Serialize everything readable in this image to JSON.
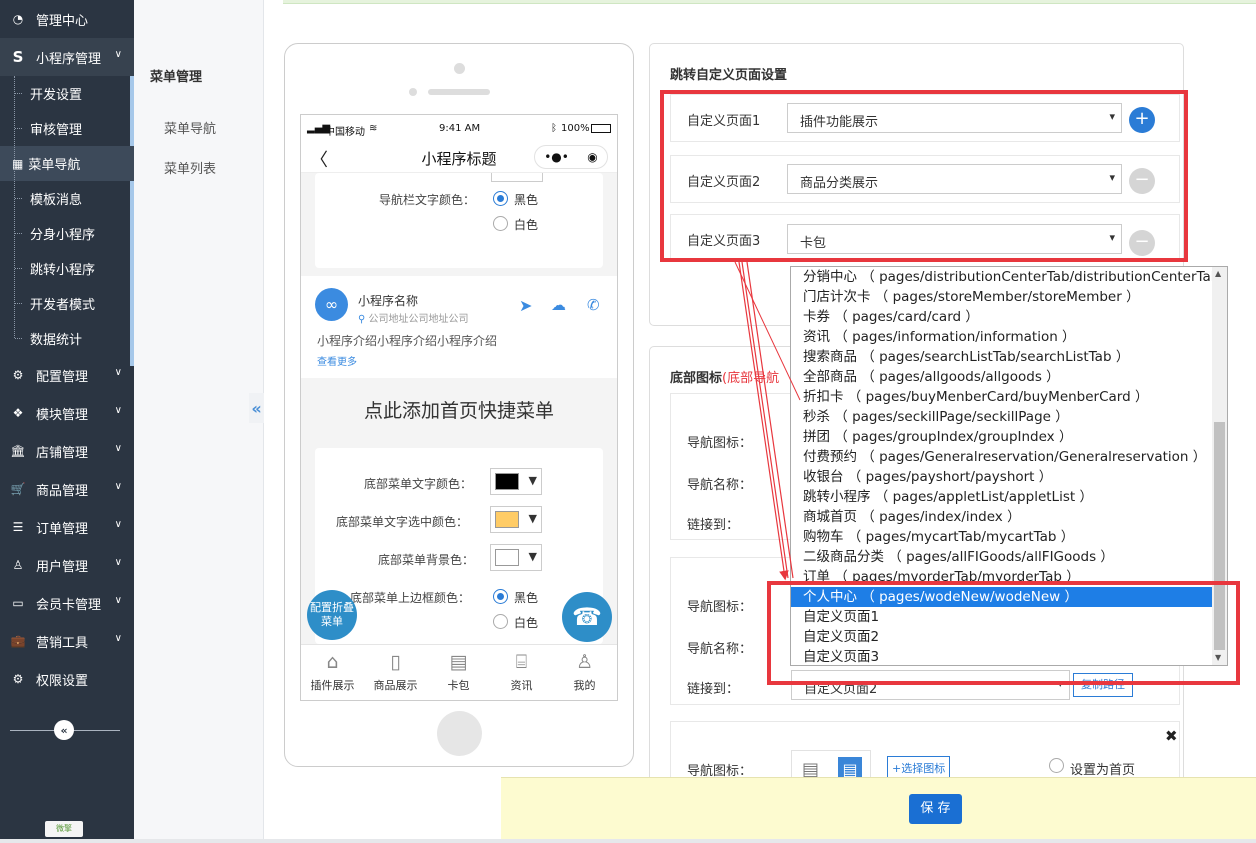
{
  "sidebar": {
    "items": [
      {
        "label": "管理中心",
        "icon": "dashboard-icon"
      },
      {
        "label": "小程序管理",
        "icon": "s-icon"
      },
      {
        "label": "配置管理",
        "icon": "cog-icon"
      },
      {
        "label": "模块管理",
        "icon": "cubes-icon"
      },
      {
        "label": "店铺管理",
        "icon": "bank-icon"
      },
      {
        "label": "商品管理",
        "icon": "cart-icon"
      },
      {
        "label": "订单管理",
        "icon": "list-icon"
      },
      {
        "label": "用户管理",
        "icon": "user-icon"
      },
      {
        "label": "会员卡管理",
        "icon": "card-icon"
      },
      {
        "label": "营销工具",
        "icon": "briefcase-icon"
      },
      {
        "label": "权限设置",
        "icon": "gear-icon"
      }
    ],
    "sub": [
      "开发设置",
      "审核管理",
      "菜单导航",
      "模板消息",
      "分身小程序",
      "跳转小程序",
      "开发者模式",
      "数据统计"
    ],
    "collapse_glyph": "«",
    "logo_text": "微擎"
  },
  "submenu": {
    "title": "菜单管理",
    "items": [
      "菜单导航",
      "菜单列表"
    ]
  },
  "collapse_glyph": "«",
  "phone": {
    "carrier": "中国移动",
    "time": "9:41 AM",
    "battery": "100%",
    "nav_title": "小程序标题",
    "nav_text_color_label": "导航栏文字颜色：",
    "black": "黑色",
    "white": "白色",
    "shop_name": "小程序名称",
    "shop_address": "公司地址公司地址公司",
    "shop_intro": "小程序介绍小程序介绍小程序介绍",
    "see_more": "查看更多",
    "add_menu": "点此添加首页快捷菜单",
    "bottom_text_color": "底部菜单文字颜色：",
    "bottom_text_selected_color": "底部菜单文字选中颜色：",
    "bottom_bg": "底部菜单背景色：",
    "bottom_border_color": "底部菜单上边框颜色：",
    "fold_menu": "配置折叠菜单",
    "tabs": [
      "插件展示",
      "商品展示",
      "卡包",
      "资讯",
      "我的"
    ],
    "colors": {
      "text": "#000000",
      "selected": "#ffcc66",
      "bg": "#ffffff"
    }
  },
  "panel": {
    "title": "跳转自定义页面设置",
    "rows": [
      {
        "label": "自定义页面1",
        "value": "插件功能展示"
      },
      {
        "label": "自定义页面2",
        "value": "商品分类展示"
      },
      {
        "label": "自定义页面3",
        "value": "卡包"
      }
    ]
  },
  "panel2": {
    "title": "底部图标",
    "title_note": "(底部导航",
    "nav_icon": "导航图标：",
    "nav_name": "导航名称：",
    "link_to": "链接到：",
    "link_value": "自定义页面2",
    "copy_path": "复制路径",
    "choose_icon": "+选择图标",
    "set_home": "设置为首页",
    "close_glyph": "✖"
  },
  "dropdown": {
    "options": [
      "分销中心 （ pages/distributionCenterTab/distributionCenterTab ）",
      "门店计次卡 （ pages/storeMember/storeMember ）",
      "卡券 （ pages/card/card ）",
      "资讯 （ pages/information/information ）",
      "搜索商品 （ pages/searchListTab/searchListTab ）",
      "全部商品 （ pages/allgoods/allgoods ）",
      "折扣卡 （ pages/buyMenberCard/buyMenberCard ）",
      "秒杀 （ pages/seckillPage/seckillPage ）",
      "拼团 （ pages/groupIndex/groupIndex ）",
      "付费预约 （ pages/Generalreservation/Generalreservation ）",
      "收银台 （ pages/payshort/payshort ）",
      "跳转小程序 （ pages/appletList/appletList ）",
      "商城首页 （ pages/index/index ）",
      "购物车 （ pages/mycartTab/mycartTab ）",
      "二级商品分类 （ pages/allFIGoods/allFIGoods ）",
      "订单 （ pages/myorderTab/myorderTab ）",
      "个人中心 （ pages/wodeNew/wodeNew ）",
      "自定义页面1",
      "自定义页面2",
      "自定义页面3"
    ],
    "selected_index": 16
  },
  "save": "保 存",
  "accent": "#e8373e",
  "primary": "#1a6fd3"
}
